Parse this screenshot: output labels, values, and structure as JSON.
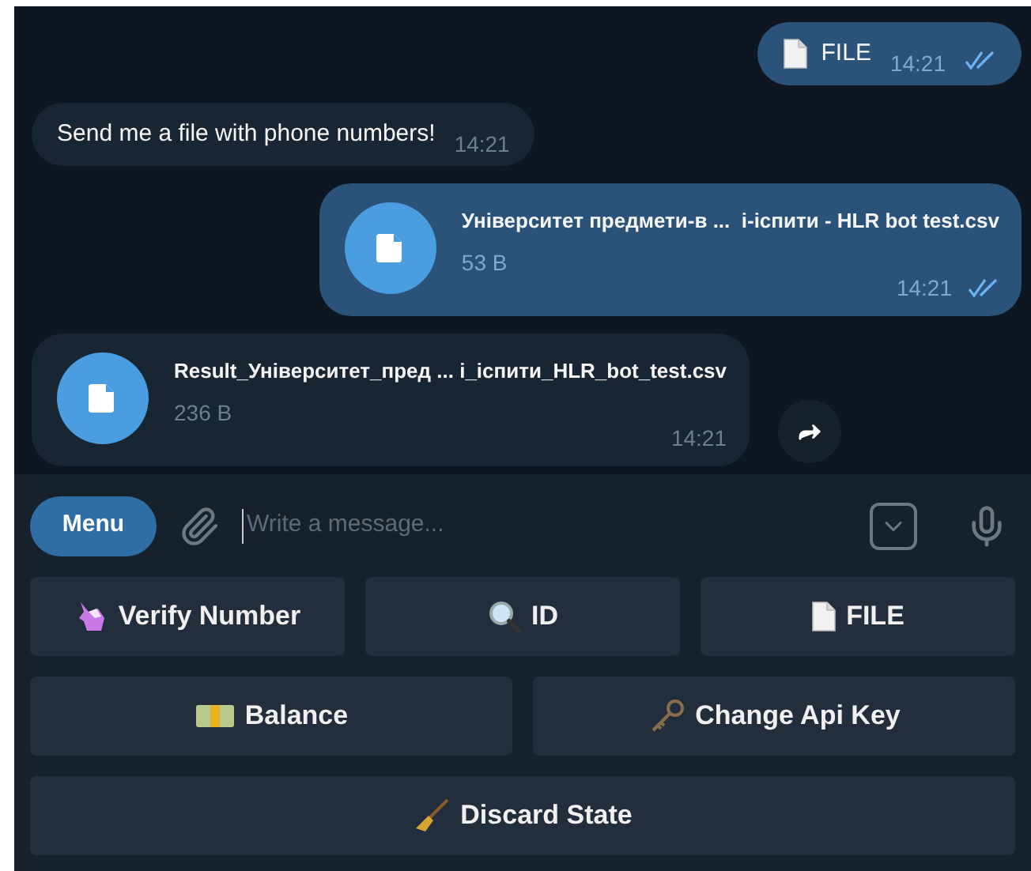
{
  "messages": [
    {
      "kind": "doc_text",
      "outgoing": true,
      "text": "FILE",
      "time": "14:21",
      "read": true
    },
    {
      "kind": "text",
      "outgoing": false,
      "text": "Send me a file with phone numbers!",
      "time": "14:21"
    },
    {
      "kind": "file",
      "outgoing": true,
      "filename": "Університет предмети-в ...  і-іспити - HLR bot test.csv",
      "size": "53 B",
      "time": "14:21",
      "read": true
    },
    {
      "kind": "file",
      "outgoing": false,
      "filename": "Result_Університет_пред ... і_іспити_HLR_bot_test.csv",
      "size": "236 B",
      "time": "14:21"
    }
  ],
  "composer": {
    "menu_label": "Menu",
    "placeholder": "Write a message..."
  },
  "keyboard": [
    [
      {
        "label": "Verify Number"
      },
      {
        "label": "ID"
      },
      {
        "label": "FILE"
      }
    ],
    [
      {
        "label": "Balance"
      },
      {
        "label": "Change Api Key"
      }
    ],
    [
      {
        "label": "Discard State"
      }
    ]
  ]
}
